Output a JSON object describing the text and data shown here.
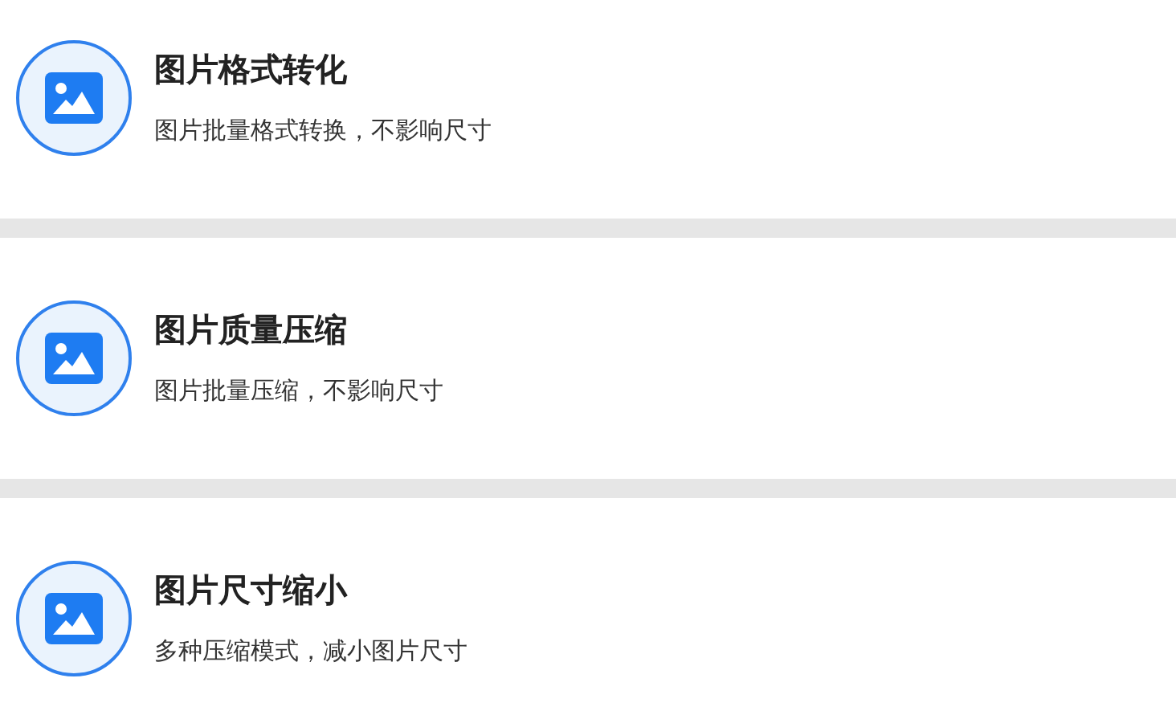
{
  "items": [
    {
      "title": "图片格式转化",
      "subtitle": "图片批量格式转换，不影响尺寸"
    },
    {
      "title": "图片质量压缩",
      "subtitle": "图片批量压缩，不影响尺寸"
    },
    {
      "title": "图片尺寸缩小",
      "subtitle": "多种压缩模式，减小图片尺寸"
    }
  ]
}
